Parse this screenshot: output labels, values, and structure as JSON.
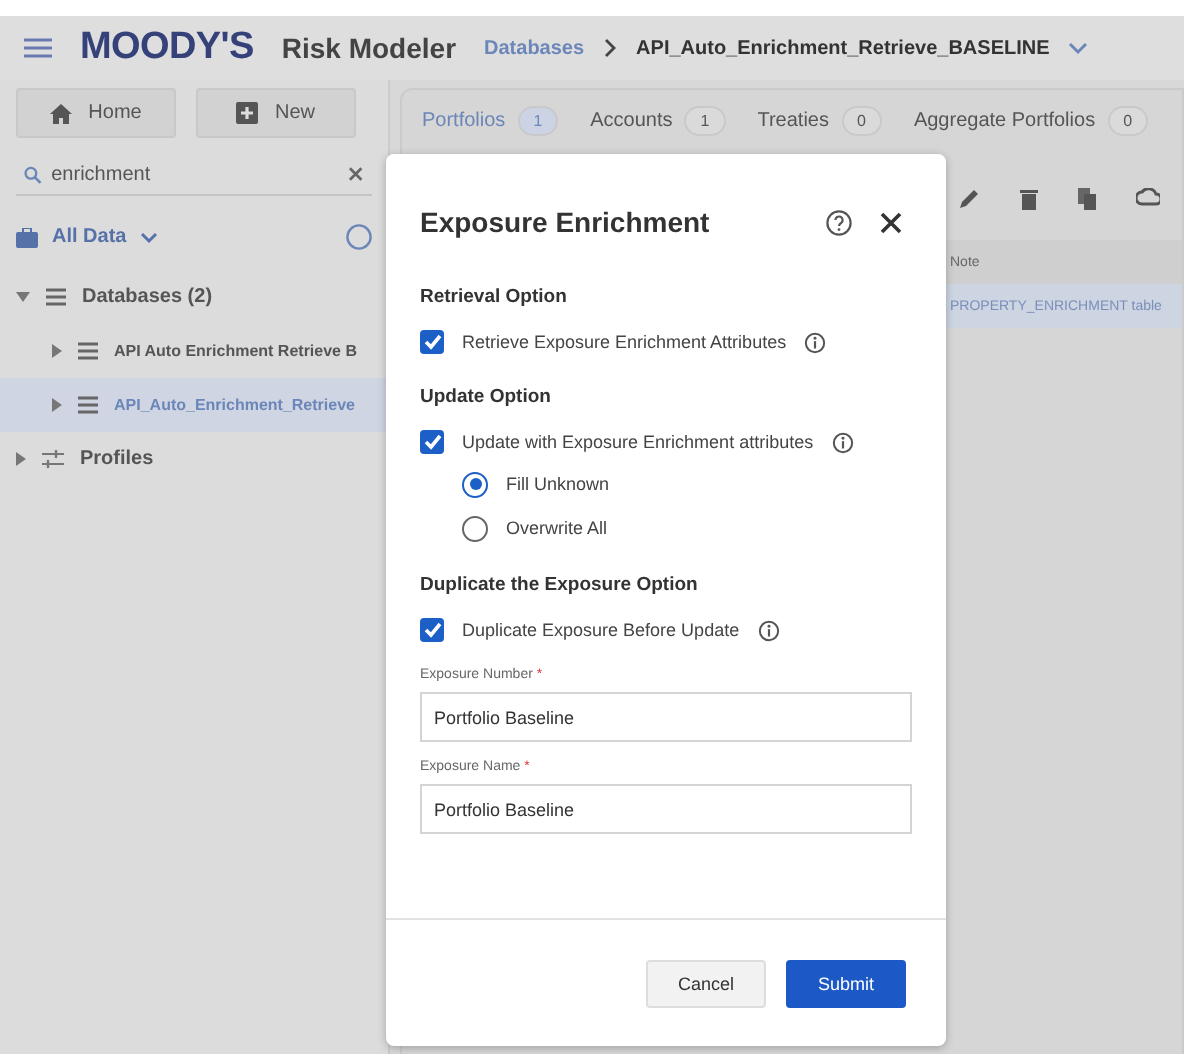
{
  "header": {
    "brand": "MOODY'S",
    "product": "Risk Modeler",
    "breadcrumb": [
      {
        "label": "Databases",
        "link": true
      },
      {
        "label": "API_Auto_Enrichment_Retrieve_BASELINE",
        "link": false
      }
    ]
  },
  "sidebar": {
    "buttons": [
      "Home",
      "New"
    ],
    "search": {
      "value": "enrichment"
    },
    "scope": "All Data",
    "tree": [
      {
        "label": "Databases (2)",
        "kind": "database",
        "expanded": true,
        "selected": false,
        "children": [
          {
            "label": "API Auto Enrichment Retrieve B",
            "kind": "database",
            "expanded": false,
            "selected": false
          },
          {
            "label": "API_Auto_Enrichment_Retrieve",
            "kind": "database",
            "expanded": false,
            "selected": true
          }
        ]
      },
      {
        "label": "Profiles",
        "kind": "profile",
        "expanded": false,
        "selected": false
      }
    ]
  },
  "tabs": [
    {
      "label": "Portfolios",
      "count": "1",
      "selected": true
    },
    {
      "label": "Accounts",
      "count": "1",
      "selected": false
    },
    {
      "label": "Treaties",
      "count": "0",
      "selected": false
    },
    {
      "label": "Aggregate Portfolios",
      "count": "0",
      "selected": false
    }
  ],
  "table": {
    "columns": [
      "Note"
    ],
    "rows": [
      {
        "note": "PROPERTY_ENRICHMENT table",
        "selected": true
      }
    ]
  },
  "dialog": {
    "title": "Exposure Enrichment",
    "sections": [
      {
        "heading": "Retrieval Option",
        "items": [
          {
            "kind": "checkbox",
            "label": "Retrieve Exposure Enrichment Attributes",
            "checked": true,
            "info": true
          }
        ]
      },
      {
        "heading": "Update Option",
        "items": [
          {
            "kind": "checkbox",
            "label": "Update with Exposure Enrichment attributes",
            "checked": true,
            "info": true
          },
          {
            "kind": "radio",
            "label": "Fill Unknown",
            "selected": true
          },
          {
            "kind": "radio",
            "label": "Overwrite All",
            "selected": false
          }
        ]
      },
      {
        "heading": "Duplicate the Exposure Option",
        "items": [
          {
            "kind": "checkbox",
            "label": "Duplicate Exposure Before Update",
            "checked": true,
            "info": true
          },
          {
            "kind": "field",
            "label": "Exposure Number",
            "required_mark": "*",
            "value": "Portfolio Baseline"
          },
          {
            "kind": "field",
            "label": "Exposure Name",
            "required_mark": "*",
            "value": "Portfolio Baseline"
          }
        ]
      }
    ],
    "buttons": [
      {
        "label": "Cancel",
        "primary": false
      },
      {
        "label": "Submit",
        "primary": true
      }
    ]
  }
}
